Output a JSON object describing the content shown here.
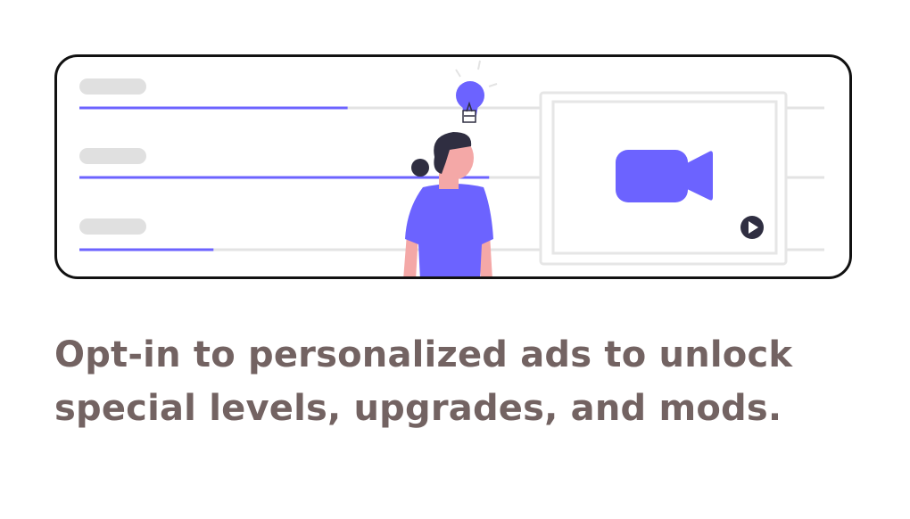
{
  "caption": {
    "line1": "Opt-in to personalized ads to unlock",
    "line2": "special levels, upgrades, and mods."
  },
  "colors": {
    "accent": "#6c63ff",
    "text": "#736362",
    "placeholder": "#e0e0e0",
    "track": "#e3e3e3",
    "frame": "#e6e6e6",
    "skin": "#f4a8a7",
    "hair": "#2f2e41",
    "border": "#111111"
  },
  "icons": {
    "video": "video-camera-icon",
    "play": "play-icon",
    "idea": "lightbulb-icon"
  },
  "progress_rows": [
    {
      "name": "row-1",
      "progress": 0.36
    },
    {
      "name": "row-2",
      "progress": 0.55
    },
    {
      "name": "row-3",
      "progress": 0.18
    }
  ]
}
